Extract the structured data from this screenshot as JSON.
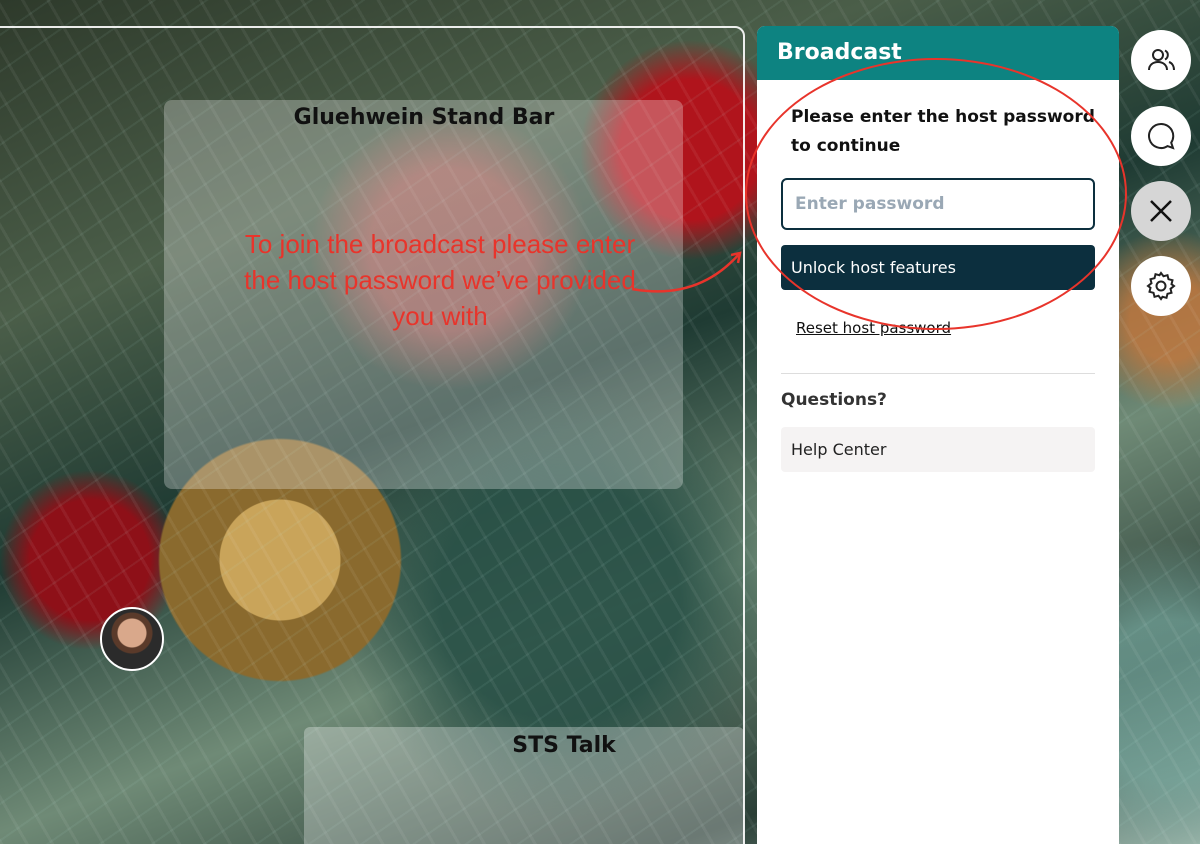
{
  "room": {
    "title": "Gluehwein Stand Bar",
    "annotation": "To join the broadcast please enter the host password we’ve provided you with"
  },
  "bottom_room": {
    "title": "STS Talk"
  },
  "panel": {
    "header": "Broadcast",
    "prompt": "Please enter the host password to continue",
    "password_placeholder": "Enter password",
    "unlock_label": "Unlock host features",
    "reset_label": "Reset host password",
    "questions_label": "Questions?",
    "help_label": "Help Center"
  },
  "sidebar": {
    "buttons": [
      "people-icon",
      "chat-icon",
      "close-icon",
      "gear-icon"
    ]
  },
  "colors": {
    "header": "#0d8381",
    "button_dark": "#0c2f3e",
    "annotation_red": "#e8342b"
  }
}
